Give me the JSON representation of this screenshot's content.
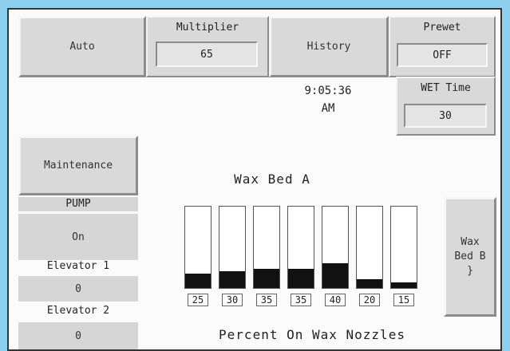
{
  "buttons": {
    "auto": "Auto",
    "history": "History",
    "maintenance": "Maintenance",
    "wax_bed_b": [
      "Wax",
      "Bed B",
      "}"
    ]
  },
  "multiplier": {
    "label": "Multiplier",
    "value": "65"
  },
  "prewet": {
    "label": "Prewet",
    "value": "OFF"
  },
  "wet_time": {
    "label": "WET Time",
    "value": "30"
  },
  "clock": {
    "time": "9:05:36",
    "ampm": "AM"
  },
  "left_column": {
    "pump_label": "PUMP",
    "pump_value": "On",
    "elevator1_label": "Elevator 1",
    "elevator1_value": "0",
    "elevator2_label": "Elevator 2",
    "elevator2_value": "0"
  },
  "wax_bed": {
    "title": "Wax Bed A",
    "footer": "Percent On Wax Nozzles",
    "nozzles": [
      {
        "label": "25",
        "percent": 18
      },
      {
        "label": "30",
        "percent": 21
      },
      {
        "label": "35",
        "percent": 24
      },
      {
        "label": "35",
        "percent": 24
      },
      {
        "label": "40",
        "percent": 30
      },
      {
        "label": "20",
        "percent": 11
      },
      {
        "label": "15",
        "percent": 7
      }
    ]
  }
}
